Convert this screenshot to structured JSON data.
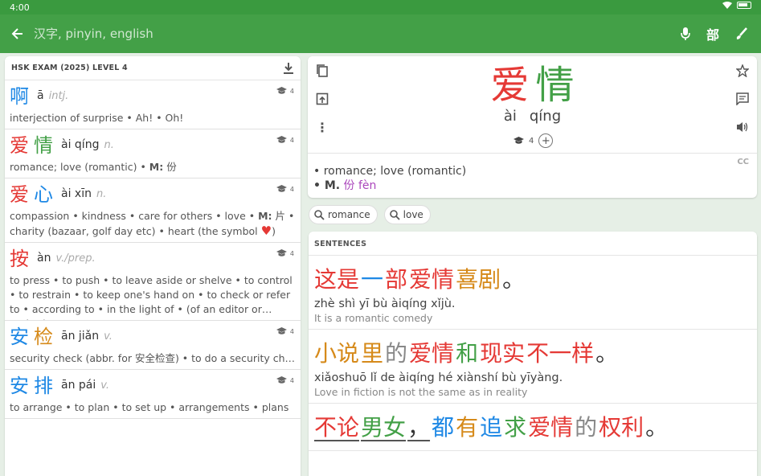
{
  "status": {
    "time": "4:00"
  },
  "appbar": {
    "search_placeholder": "汉字, pinyin, english",
    "radical_label": "部"
  },
  "list": {
    "header": "HSK EXAM (2025) LEVEL 4",
    "entries": [
      {
        "chars": [
          {
            "c": "啊",
            "tone": 3
          }
        ],
        "pinyin": "ā",
        "pos": "intj.",
        "level": "4",
        "def": "interjection of surprise • Ah! • Oh!"
      },
      {
        "chars": [
          {
            "c": "爱",
            "tone": 1
          },
          {
            "c": "情",
            "tone": 2
          }
        ],
        "pinyin": "ài qíng",
        "pos": "n.",
        "level": "4",
        "def_pre": "romance; love (romantic) • ",
        "def_m": "M:",
        "def_post": " 份"
      },
      {
        "chars": [
          {
            "c": "爱",
            "tone": 1
          },
          {
            "c": "心",
            "tone": 3
          }
        ],
        "pinyin": "ài xīn",
        "pos": "n.",
        "level": "4",
        "def_pre": "compassion • kindness • care for others • love • ",
        "def_m": "M:",
        "def_post": " 片 • charity (bazaar, golf day etc) • heart (the symbol ",
        "heart": "♥",
        "def_end": ")"
      },
      {
        "chars": [
          {
            "c": "按",
            "tone": 1
          }
        ],
        "pinyin": "àn",
        "pos": "v./prep.",
        "level": "4",
        "def": "to press • to push • to leave aside or shelve • to control • to restrain • to keep one's hand on • to check or refer to • according to • in the light of • (of an editor or author) to…"
      },
      {
        "chars": [
          {
            "c": "安",
            "tone": 3
          },
          {
            "c": "检",
            "tone": 4
          }
        ],
        "pinyin": "ān jiǎn",
        "pos": "v.",
        "level": "4",
        "def": "security check (abbr. for 安全检查) • to do a security check"
      },
      {
        "chars": [
          {
            "c": "安",
            "tone": 3
          },
          {
            "c": "排",
            "tone": 3
          }
        ],
        "pinyin": "ān pái",
        "pos": "v.",
        "level": "4",
        "def": "to arrange • to plan • to set up • arrangements • plans"
      }
    ]
  },
  "detail": {
    "chars": [
      {
        "c": "爱",
        "tone": 1
      },
      {
        "c": "情",
        "tone": 2
      }
    ],
    "pinyin": [
      "ài",
      "qíng"
    ],
    "level": "4",
    "def1": "• romance; love (romantic)",
    "def2_m": "• M.",
    "def2_cl": "份 fèn",
    "cc": "CC"
  },
  "chips": [
    "romance",
    "love"
  ],
  "sentences": {
    "header": "SENTENCES",
    "items": [
      {
        "zh": [
          {
            "c": "这是",
            "t": 1
          },
          {
            "c": "一",
            "t": 3
          },
          {
            "c": "部",
            "t": 1
          },
          {
            "c": "爱情",
            "t": 1
          },
          {
            "c": "喜剧",
            "t": 4
          },
          {
            "c": "。",
            "t": 0
          }
        ],
        "pinyin": "zhè shì yī bù àiqíng xǐjù.",
        "en": "It is a romantic comedy"
      },
      {
        "zh": [
          {
            "c": "小说",
            "t": 4
          },
          {
            "c": "里",
            "t": 4
          },
          {
            "c": "的",
            "t": 5
          },
          {
            "c": "爱情",
            "t": 1
          },
          {
            "c": "和",
            "t": 2
          },
          {
            "c": "现实",
            "t": 1
          },
          {
            "c": "不一样",
            "t": 1
          },
          {
            "c": "。",
            "t": 0
          }
        ],
        "pinyin": "xiǎoshuō lǐ de àiqíng hé xiànshí bù yīyàng.",
        "en": "Love in fiction is not the same as in reality"
      },
      {
        "zh": [
          {
            "c": "不论",
            "t": 1
          },
          {
            "c": "男女",
            "t": 2
          },
          {
            "c": "，",
            "t": 0
          },
          {
            "c": "都",
            "t": 3
          },
          {
            "c": "有",
            "t": 4
          },
          {
            "c": "追",
            "t": 3
          },
          {
            "c": "求",
            "t": 2
          },
          {
            "c": "爱情",
            "t": 1
          },
          {
            "c": "的",
            "t": 5
          },
          {
            "c": "权利",
            "t": 1
          },
          {
            "c": "。",
            "t": 0
          }
        ],
        "pinyin": "",
        "en": ""
      }
    ]
  },
  "colors": {
    "accent": "#43a047",
    "tone1": "#e53935",
    "tone2": "#43a047",
    "tone3": "#1e88e5",
    "tone4": "#d68a1a",
    "tone5": "#888888"
  }
}
